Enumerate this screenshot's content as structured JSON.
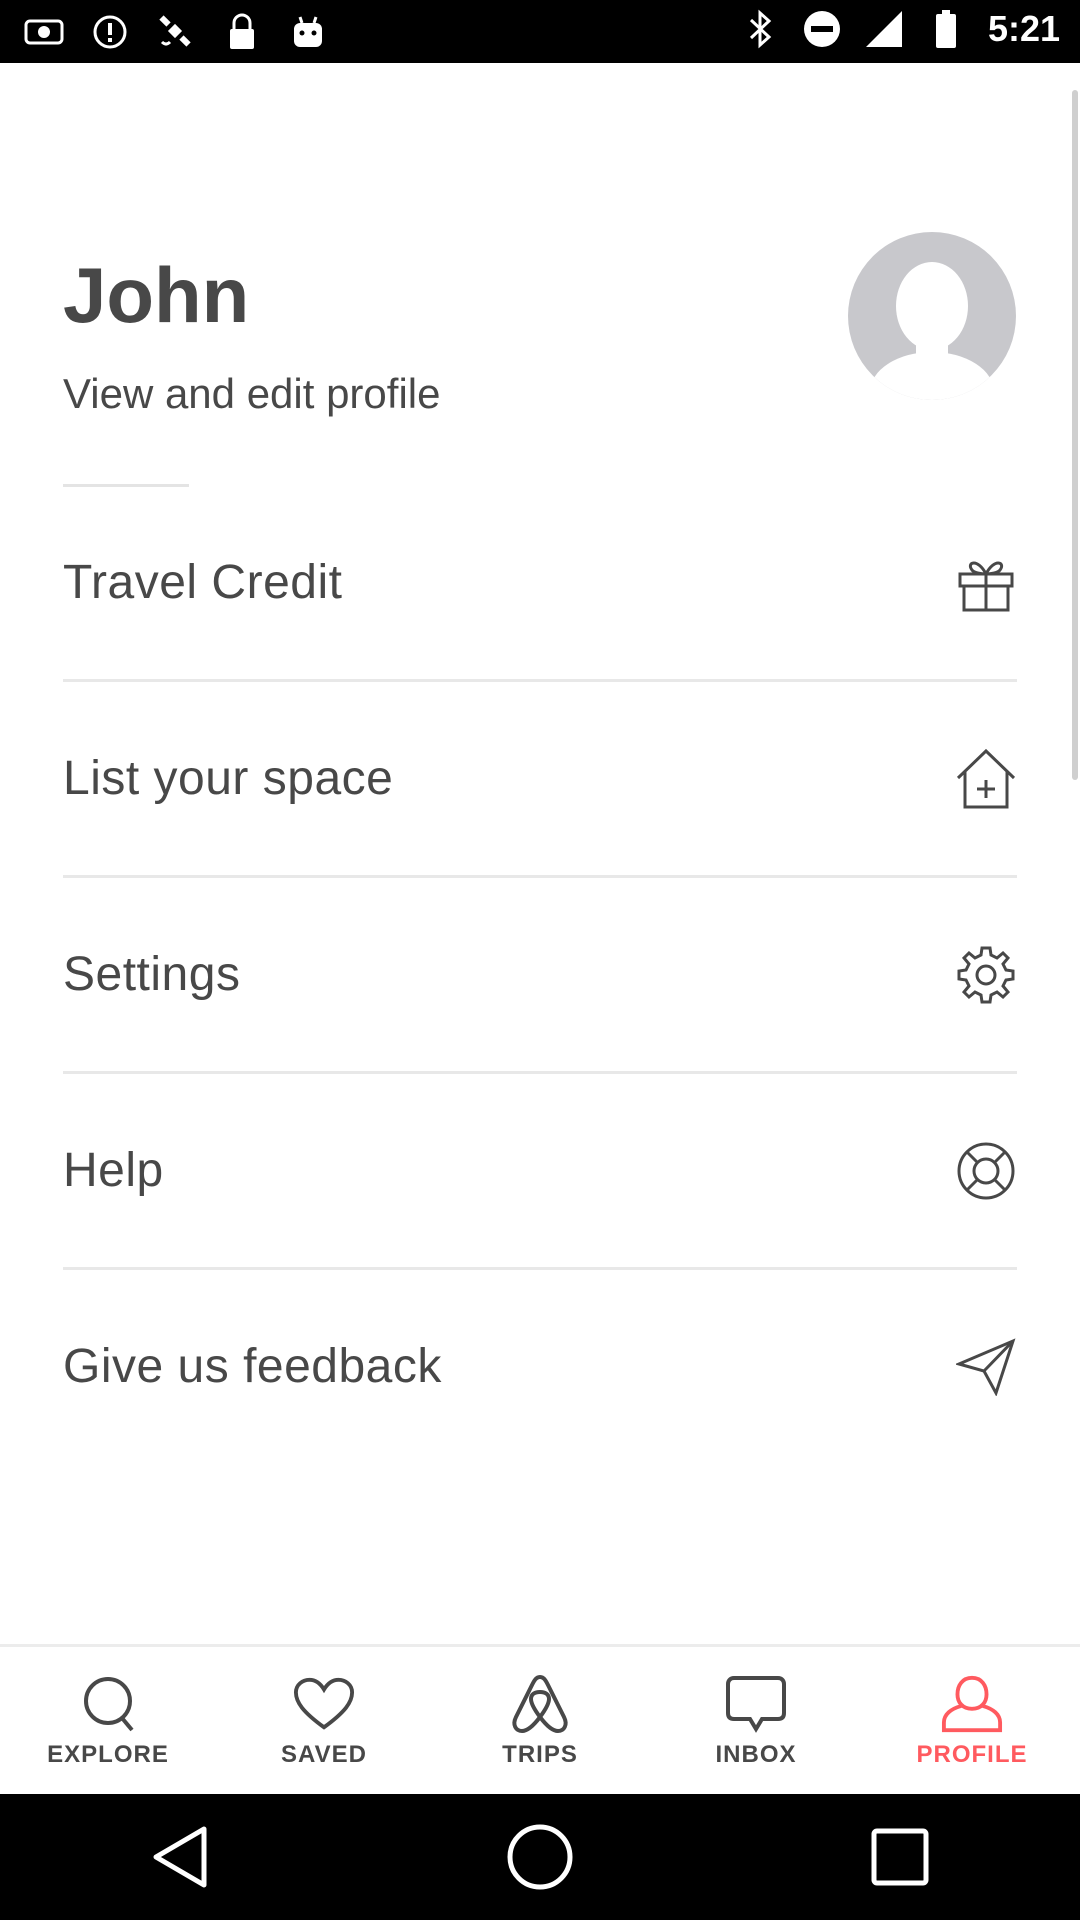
{
  "status_bar": {
    "time": "5:21",
    "left_icons": [
      "tv-icon",
      "alert-icon",
      "satellite-icon",
      "lock-icon",
      "android-icon"
    ],
    "right_icons": [
      "bluetooth-icon",
      "do-not-disturb-icon",
      "signal-icon",
      "battery-icon"
    ]
  },
  "profile": {
    "name": "John",
    "subtitle": "View and edit profile",
    "avatar_icon": "user-avatar-icon"
  },
  "menu": {
    "items": [
      {
        "label": "Travel Credit",
        "icon": "gift-icon"
      },
      {
        "label": "List your space",
        "icon": "house-plus-icon"
      },
      {
        "label": "Settings",
        "icon": "gear-icon"
      },
      {
        "label": "Help",
        "icon": "lifebuoy-icon"
      },
      {
        "label": "Give us feedback",
        "icon": "paper-plane-icon"
      }
    ]
  },
  "bottom_nav": {
    "items": [
      {
        "label": "EXPLORE",
        "icon": "search-icon",
        "active": false
      },
      {
        "label": "SAVED",
        "icon": "heart-icon",
        "active": false
      },
      {
        "label": "TRIPS",
        "icon": "airbnb-logo-icon",
        "active": false
      },
      {
        "label": "INBOX",
        "icon": "chat-bubble-icon",
        "active": false
      },
      {
        "label": "PROFILE",
        "icon": "person-icon",
        "active": true
      }
    ],
    "active_color": "#ff5a5f",
    "inactive_color": "#484848"
  },
  "system_nav": [
    "back-icon",
    "home-icon",
    "recents-icon"
  ]
}
